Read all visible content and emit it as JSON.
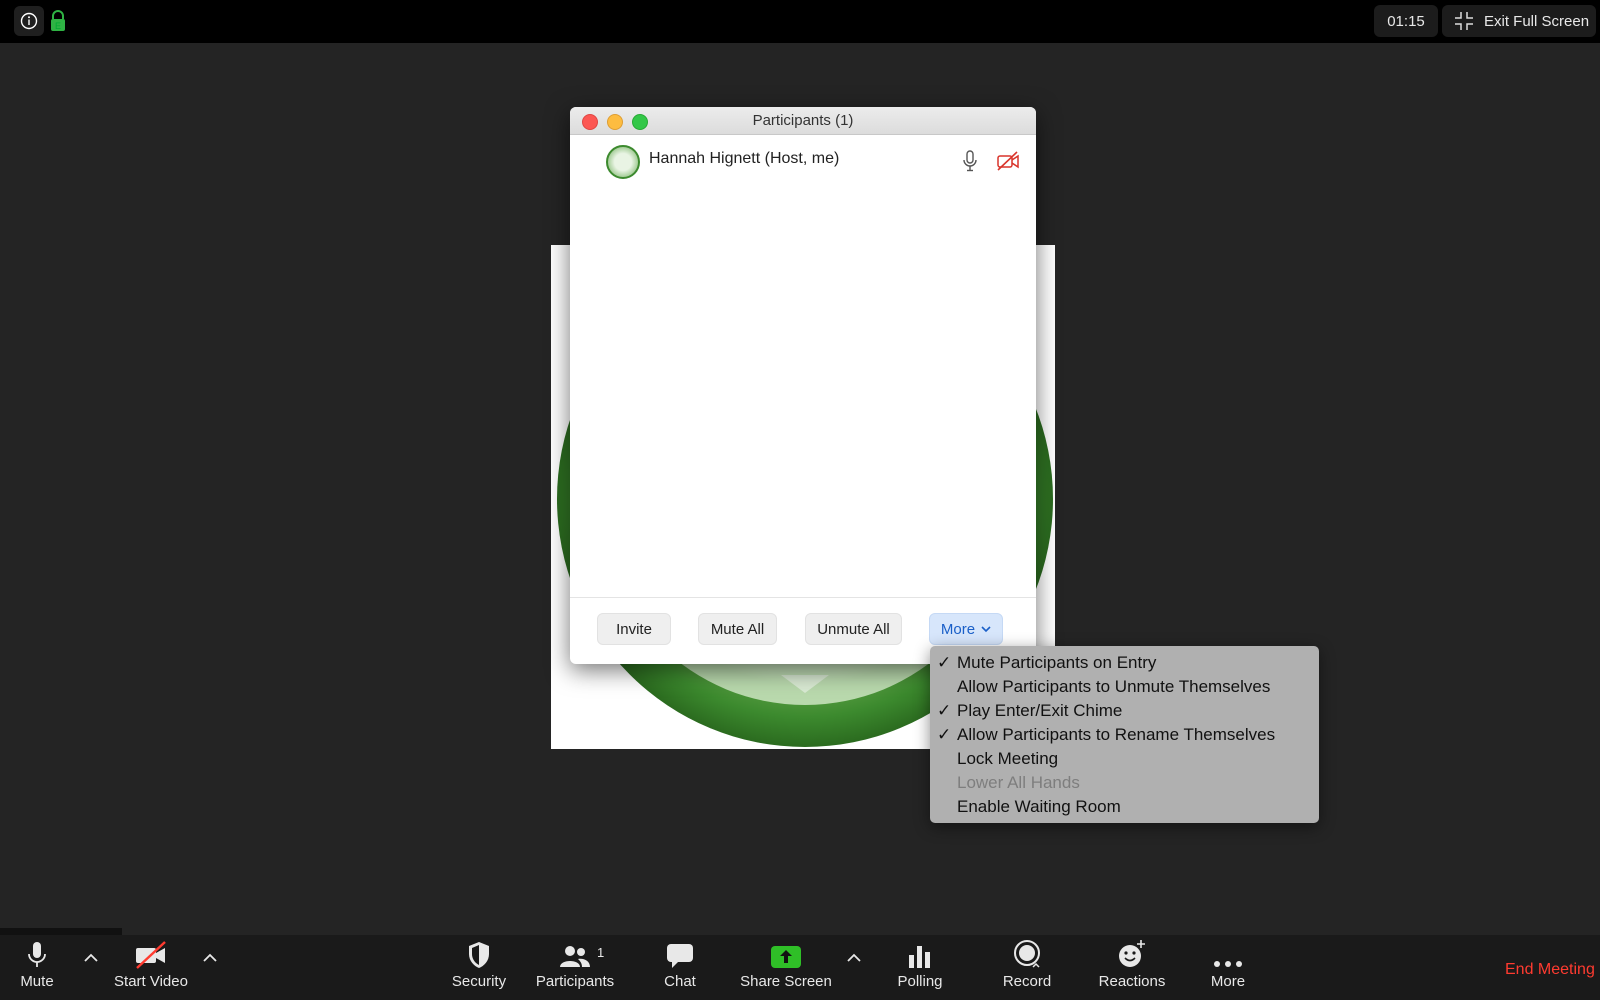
{
  "topbar": {
    "timer": "01:15",
    "exit_fullscreen": "Exit Full Screen",
    "icons": {
      "info": "info-icon",
      "lock": "lock-icon",
      "exit": "exit-fullscreen-icon"
    },
    "lock_color": "#2fb344"
  },
  "participants_window": {
    "title": "Participants (1)",
    "participants": [
      {
        "name": "Hannah Hignett (Host, me)",
        "audio": "mic-on",
        "video": "camera-off"
      }
    ],
    "buttons": {
      "invite": "Invite",
      "mute_all": "Mute All",
      "unmute_all": "Unmute All",
      "more": "More"
    }
  },
  "more_menu": {
    "items": [
      {
        "label": "Mute Participants on Entry",
        "checked": true,
        "enabled": true
      },
      {
        "label": "Allow Participants to Unmute Themselves",
        "checked": false,
        "enabled": true
      },
      {
        "label": "Play Enter/Exit Chime",
        "checked": true,
        "enabled": true
      },
      {
        "label": "Allow Participants to Rename Themselves",
        "checked": true,
        "enabled": true
      },
      {
        "label": "Lock Meeting",
        "checked": false,
        "enabled": true
      },
      {
        "label": "Lower All Hands",
        "checked": false,
        "enabled": false
      },
      {
        "label": "Enable Waiting Room",
        "checked": false,
        "enabled": true
      }
    ],
    "check_glyph": "✓"
  },
  "toolbar": {
    "mute": "Mute",
    "start_video": "Start Video",
    "security": "Security",
    "participants": "Participants",
    "participants_count": "1",
    "chat": "Chat",
    "share_screen": "Share Screen",
    "polling": "Polling",
    "record": "Record",
    "reactions": "Reactions",
    "more": "More",
    "end_meeting": "End Meeting",
    "share_color": "#2fbf27",
    "end_color": "#ff3b30"
  }
}
